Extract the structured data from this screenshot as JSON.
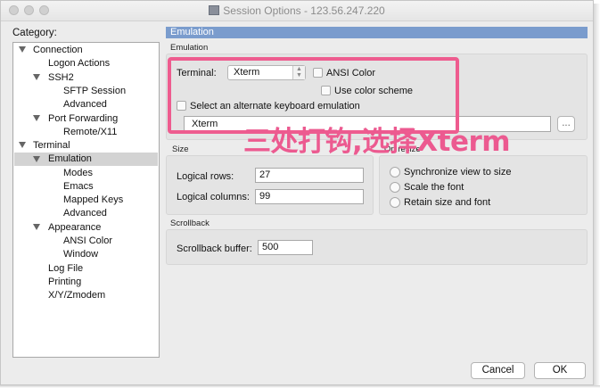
{
  "window": {
    "title": "Session Options - 123.56.247.220"
  },
  "category": {
    "label": "Category:",
    "items": [
      {
        "label": "Connection",
        "expanded": true
      },
      {
        "label": "Logon Actions"
      },
      {
        "label": "SSH2",
        "expanded": true
      },
      {
        "label": "SFTP Session"
      },
      {
        "label": "Advanced"
      },
      {
        "label": "Port Forwarding",
        "expanded": true
      },
      {
        "label": "Remote/X11"
      },
      {
        "label": "Terminal",
        "expanded": true
      },
      {
        "label": "Emulation",
        "expanded": true,
        "selected": true
      },
      {
        "label": "Modes"
      },
      {
        "label": "Emacs"
      },
      {
        "label": "Mapped Keys"
      },
      {
        "label": "Advanced"
      },
      {
        "label": "Appearance",
        "expanded": true
      },
      {
        "label": "ANSI Color"
      },
      {
        "label": "Window"
      },
      {
        "label": "Log File"
      },
      {
        "label": "Printing"
      },
      {
        "label": "X/Y/Zmodem"
      }
    ]
  },
  "panel": {
    "title": "Emulation",
    "emulation_section": "Emulation",
    "terminal_label": "Terminal:",
    "terminal_value": "Xterm",
    "ansi_color": "ANSI Color",
    "use_color_scheme": "Use color scheme",
    "alternate_keyboard": "Select an alternate keyboard emulation",
    "keyboard_value": "Xterm",
    "browse_label": "...",
    "size_section": "Size",
    "logical_rows_label": "Logical rows:",
    "logical_rows_value": "27",
    "logical_columns_label": "Logical columns:",
    "logical_columns_value": "99",
    "on_resize_section": "On resize",
    "sync_view": "Synchronize view to size",
    "scale_font": "Scale the font",
    "retain_size": "Retain size and font",
    "scrollback_section": "Scrollback",
    "scrollback_label": "Scrollback buffer:",
    "scrollback_value": "500"
  },
  "buttons": {
    "cancel": "Cancel",
    "ok": "OK"
  },
  "annotation": {
    "text": "三处打钩,选择Xterm",
    "color": "#ec5a90"
  }
}
